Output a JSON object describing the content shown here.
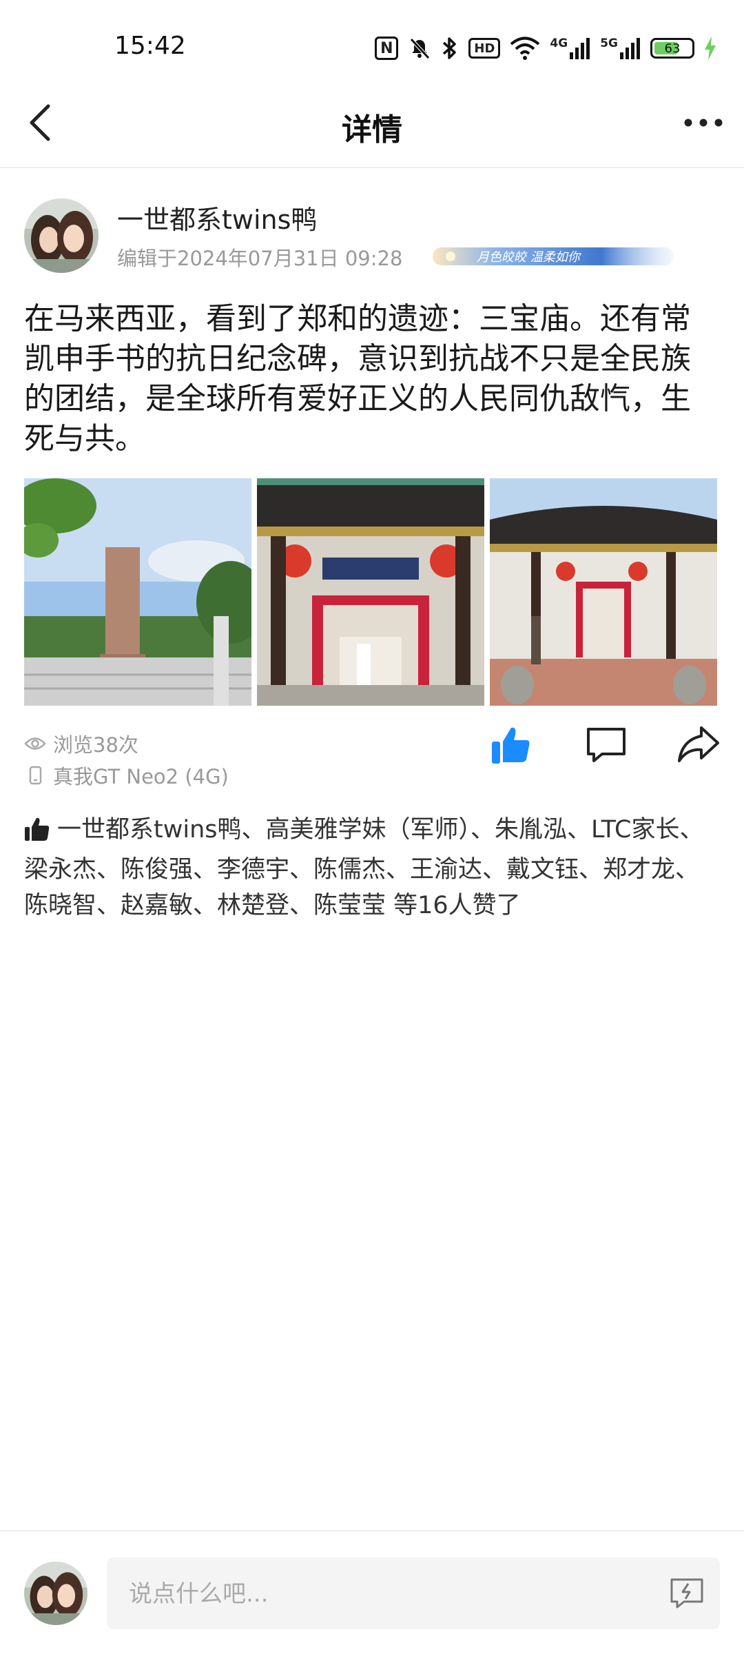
{
  "status_bar": {
    "time": "15:42",
    "nfc": "N",
    "hd": "HD",
    "net1": "4G",
    "net2": "5G",
    "battery": "63"
  },
  "nav": {
    "title": "详情"
  },
  "post": {
    "author": "一世都系twins鸭",
    "edit_time": "编辑于2024年07月31日 09:28",
    "decor_text": "月色皎皎 温柔如你",
    "text": "在马来西亚，看到了郑和的遗迹：三宝庙。还有常凯申手书的抗日纪念碑，意识到抗战不只是全民族的团结，是全球所有爱好正义的人民同仇敌忾，生死与共。",
    "photo_names": [
      "monument-photo",
      "temple-entrance-photo",
      "temple-facade-photo"
    ],
    "views": "浏览38次",
    "device": "真我GT Neo2 (4G)",
    "likes": "一世都系twins鸭、高美雅学妹（军师）、朱胤泓、LTC家长、梁永杰、陈俊强、李德宇、陈儒杰、王渝达、戴文钰、郑才龙、陈晓智、赵嘉敏、林楚登、陈莹莹 等16人赞了"
  },
  "comment": {
    "placeholder": "说点什么吧..."
  },
  "colors": {
    "accent": "#1a8cff",
    "muted": "#999999",
    "battery": "#6ccf5f"
  },
  "icons": [
    "back-icon",
    "more-icon",
    "eye-icon",
    "phone-icon",
    "like-icon",
    "comment-icon",
    "share-icon",
    "thumbs-up-icon",
    "emoji-icon"
  ]
}
